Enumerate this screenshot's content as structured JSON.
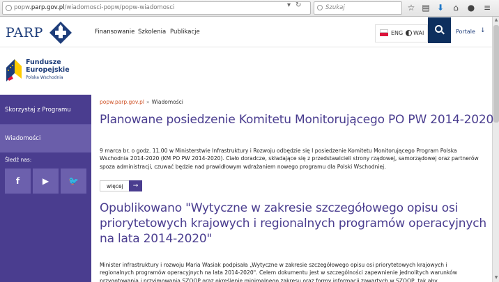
{
  "browser": {
    "url_prefix": "popw.",
    "url_domain": "parp.gov.pl",
    "url_path": "/wiadomosci-popw/popw-wiadomosci",
    "search_placeholder": "Szukaj"
  },
  "header": {
    "logo_text": "PARP",
    "nav": [
      "Finansowanie",
      "Szkolenia",
      "Publikacje"
    ],
    "lang_label": "ENG",
    "wai_label": "WAI",
    "portale_label": "Portale"
  },
  "banner": {
    "line1": "Fundusze",
    "line2": "Europejskie",
    "line3": "Polska Wschodnia"
  },
  "sidebar": {
    "items": [
      "Skorzystaj z Programu",
      "Wiadomości"
    ],
    "follow_label": "Śledź nas:",
    "social": [
      "f",
      "▶",
      "🐦"
    ]
  },
  "main": {
    "breadcrumb_home": "popw.parp.gov.pl",
    "breadcrumb_sep": "»",
    "breadcrumb_current": "Wiadomości",
    "post1_title": "Planowane posiedzenie Komitetu Monitorującego PO PW 2014-2020",
    "post1_body": "9 marca br. o godz. 11.00 w Ministerstwie Infrastruktury i Rozwoju odbędzie się I posiedzenie Komitetu Monitorującego Program Polska Wschodnia 2014-2020 (KM PO PW 2014-2020). Ciało doradcze, składające się z przedstawicieli strony rządowej, samorządowej oraz partnerów spoza administracji, czuwać będzie nad prawidłowym wdrażaniem nowego programu dla Polski Wschodniej.",
    "more_label": "więcej",
    "more_arrow": "→",
    "post2_title": "Opublikowano \"Wytyczne w zakresie szczegółowego opisu osi priorytetowych krajowych i regionalnych programów operacyjnych na lata 2014-2020\"",
    "post2_body": "Minister infrastruktury i rozwoju Maria Wasiak podpisała „Wytyczne w zakresie szczegółowego opisu osi priorytetowych krajowych i regionalnych programów operacyjnych na lata 2014-2020\". Celem dokumentu jest w szczególności zapewnienie jednolitych warunków przygotowania i przyjmowania SZOOP oraz określenie minimalnego zakresu oraz formy informacji zawartych w SZOOP, tak aby"
  }
}
